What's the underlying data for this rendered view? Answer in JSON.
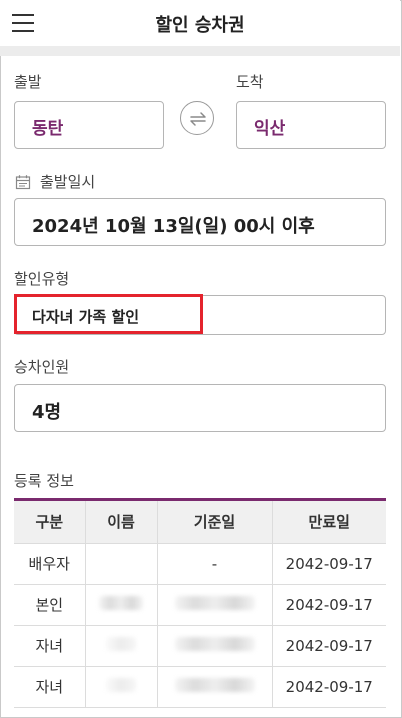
{
  "header": {
    "title": "할인 승차권",
    "menu_icon": "hamburger-menu-icon"
  },
  "route": {
    "departure_label": "출발",
    "departure_value": "동탄",
    "arrival_label": "도착",
    "arrival_value": "익산",
    "swap_icon": "swap-arrows-icon"
  },
  "datetime": {
    "label": "출발일시",
    "value": "2024년 10월 13일(일) 00시 이후",
    "icon": "calendar-icon"
  },
  "discount": {
    "label": "할인유형",
    "value": "다자녀 가족 할인",
    "highlight_color": "#e4232d"
  },
  "passengers": {
    "label": "승차인원",
    "value": "4명"
  },
  "registration": {
    "title": "등록 정보",
    "columns": [
      "구분",
      "이름",
      "기준일",
      "만료일"
    ],
    "rows": [
      {
        "type": "배우자",
        "name": "",
        "base_date": "-",
        "expiry": "2042-09-17"
      },
      {
        "type": "본인",
        "name": "",
        "base_date": "",
        "expiry": "2042-09-17"
      },
      {
        "type": "자녀",
        "name": "",
        "base_date": "",
        "expiry": "2042-09-17"
      },
      {
        "type": "자녀",
        "name": "",
        "base_date": "",
        "expiry": "2042-09-17"
      }
    ]
  },
  "colors": {
    "accent": "#7a2a6e",
    "table_header_bg": "#f0f0f0"
  }
}
